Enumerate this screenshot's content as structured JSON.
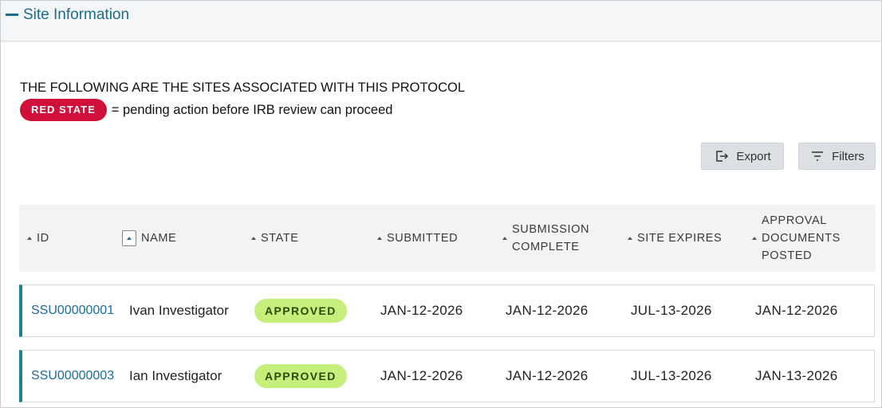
{
  "section": {
    "title": "Site Information"
  },
  "intro": {
    "text": "THE FOLLOWING ARE THE SITES ASSOCIATED WITH THIS PROTOCOL",
    "legend_badge": "RED STATE",
    "legend_text": "= pending action before IRB review can proceed"
  },
  "toolbar": {
    "export_label": "Export",
    "export_icon": "export-icon",
    "filters_label": "Filters",
    "filters_icon": "filter-icon"
  },
  "table": {
    "columns": [
      {
        "label": "ID"
      },
      {
        "label": "NAME"
      },
      {
        "label": "STATE"
      },
      {
        "label": "SUBMITTED"
      },
      {
        "label": "SUBMISSION COMPLETE"
      },
      {
        "label": "SITE EXPIRES"
      },
      {
        "label": "APPROVAL DOCUMENTS POSTED"
      }
    ],
    "rows": [
      {
        "id": "SSU00000001",
        "name": "Ivan Investigator",
        "state": "APPROVED",
        "submitted": "JAN-12-2026",
        "submission_complete": "JAN-12-2026",
        "site_expires": "JUL-13-2026",
        "documents_posted": "JAN-12-2026"
      },
      {
        "id": "SSU00000003",
        "name": "Ian Investigator",
        "state": "APPROVED",
        "submitted": "JAN-12-2026",
        "submission_complete": "JAN-12-2026",
        "site_expires": "JUL-13-2026",
        "documents_posted": "JAN-13-2026"
      }
    ]
  },
  "colors": {
    "accent": "#1b6d8a",
    "red_state": "#d0103a",
    "approved_badge": "#c6ee7a"
  }
}
